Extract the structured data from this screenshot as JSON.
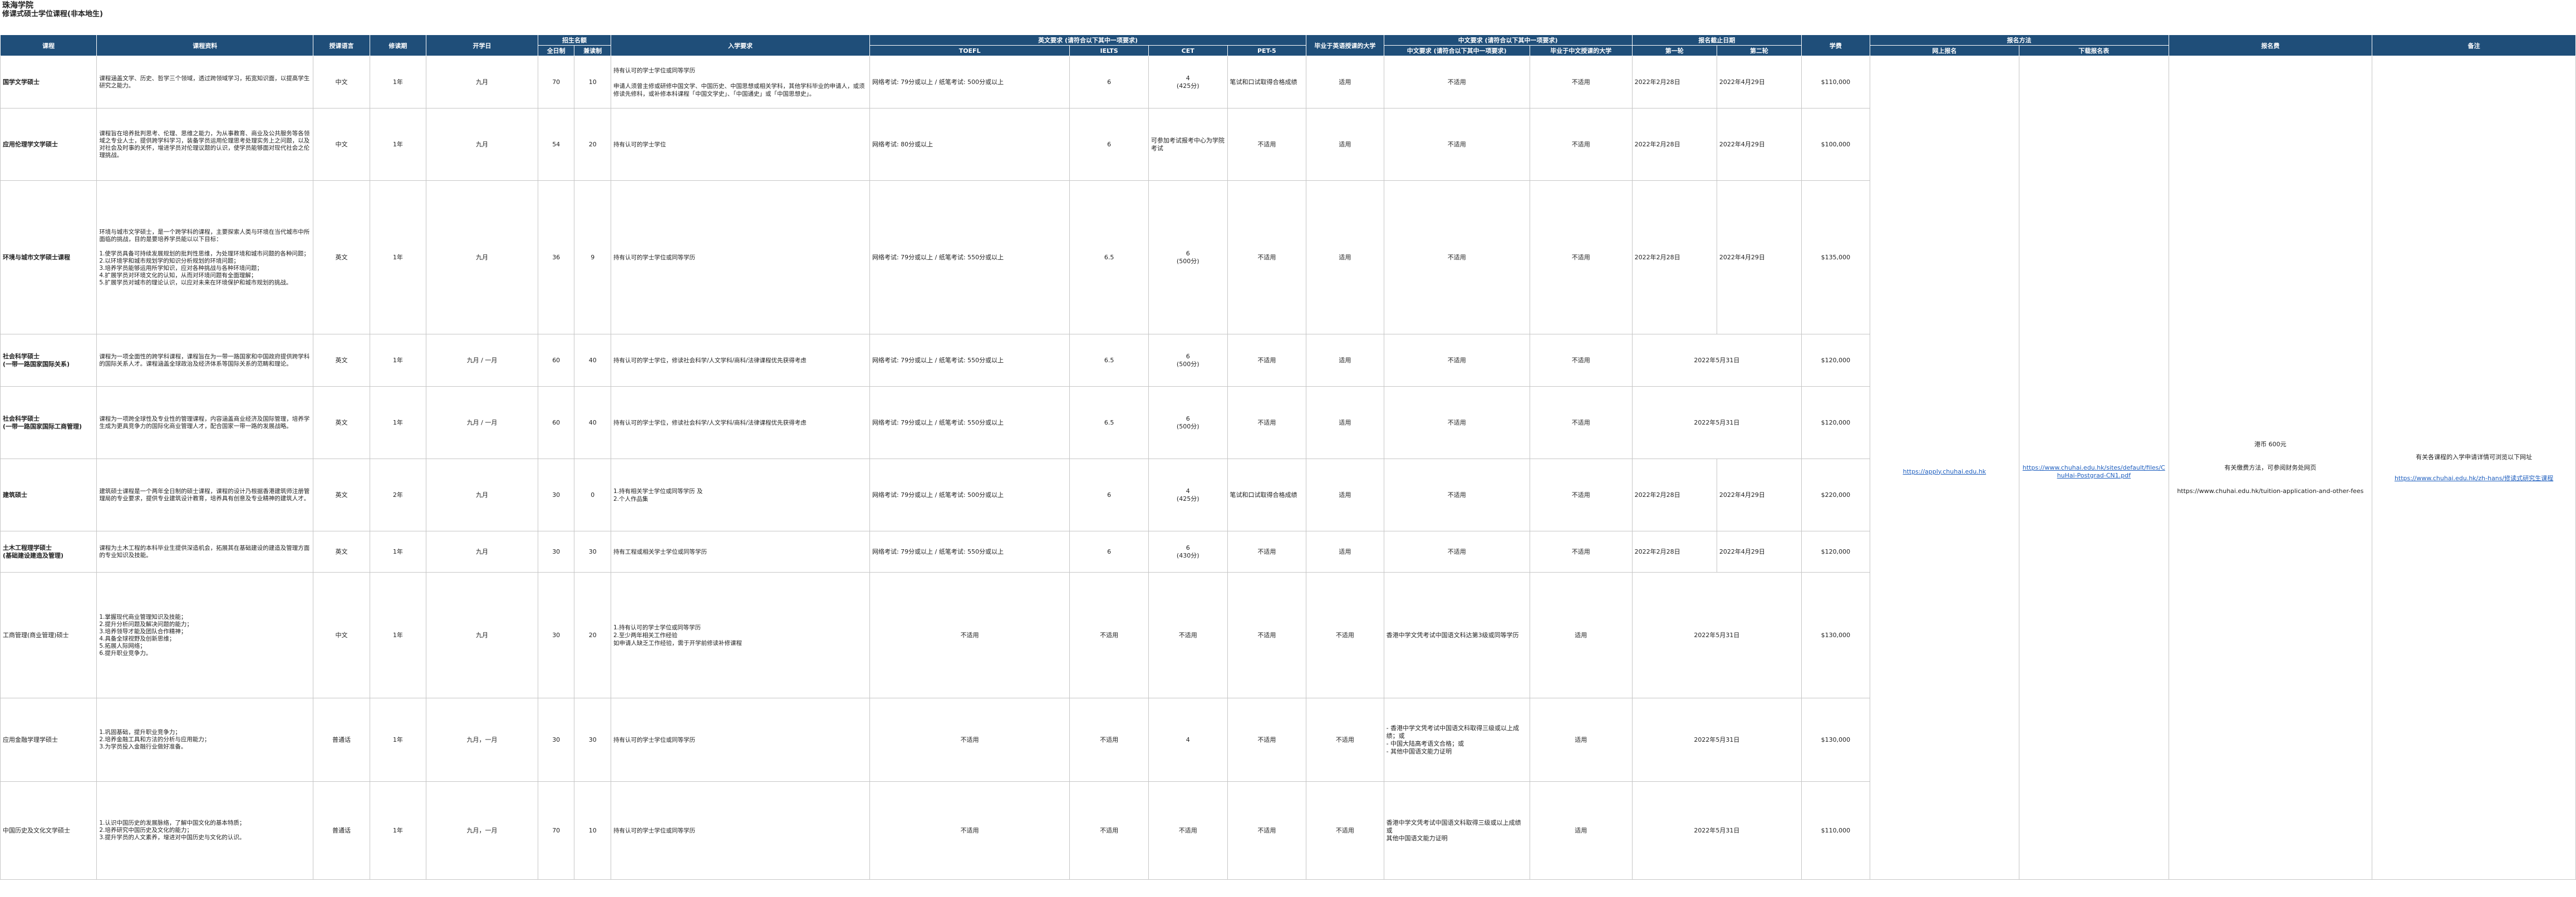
{
  "title": {
    "line1": "珠海学院",
    "line2": "修课式硕士学位课程(非本地生)"
  },
  "headers": {
    "program": "课程",
    "detail": "课程资料",
    "language": "授课语言",
    "duration": "修读期",
    "intake": "开学日",
    "quota": "招生名额",
    "quota_total": "全日制",
    "quota_part": "兼读制",
    "entry": "入学要求",
    "english": "英文要求 (请符合以下其中一项要求)",
    "toefl": "TOEFL",
    "ielts": "IELTS",
    "cet": "CET",
    "pet": "PET-5",
    "grad_english": "毕业于英语授课的大学",
    "chinese": "中文要求 (请符合以下其中一项要求)",
    "chinese_req": "中文要求 (请符合以下其中一项要求)",
    "grad_chinese": "毕业于中文授课的大学",
    "deadline": "报名截止日期",
    "round1": "第一轮",
    "round2": "第二轮",
    "tuition": "学费",
    "method": "报名方法",
    "online": "网上报名",
    "download": "下载报名表",
    "fee": "报名费",
    "remark": "备注"
  },
  "shared": {
    "online_link": "https://apply.chuhai.edu.hk",
    "download_link": "https://www.chuhai.edu.hk/sites/default/files/ChuHai-Postgrad-CN1.pdf",
    "fee_line1": "港币 600元",
    "fee_line2": "有关缴费方法，可参阅财务处网页",
    "fee_line3": "https://www.chuhai.edu.hk/tuition-application-and-other-fees",
    "remark_line1": "有关各课程的入学申请详情可浏览以下网址",
    "remark_line2": "https://www.chuhai.edu.hk/zh-hans/修读式研究生课程"
  },
  "rows": [
    {
      "name": "国学文学硕士",
      "detail": "课程涵盖文学、历史、哲学三个领域，透过跨领域学习，拓宽知识面，以提高学生研究之能力。",
      "language": "中文",
      "duration": "1年",
      "intake": "九月",
      "full": "70",
      "part": "10",
      "entry": "持有认可的学士学位或同等学历\n\n申请人须曾主修或研修中国文学、中国历史、中国思想或相关学科，其他学科毕业的申请人，或须修读先修科，或补修本科课程「中国文学史」、「中国通史」或「中国思想史」。",
      "toefl": "网络考试: 79分或以上 / 纸笔考试: 500分或以上",
      "ielts": "6",
      "cet": "4\n(425分)",
      "pet": "笔试和口试取得合格成绩",
      "grad_en": "适用",
      "chinese": "不适用",
      "grad_cn": "不适用",
      "round1": "2022年2月28日",
      "round2": "2022年4月29日",
      "tuition": "$110,000"
    },
    {
      "name": "应用伦理学文学硕士",
      "detail": "课程旨在培养批判思考、伦理、思维之能力，为从事教育、商业及公共服务等各领域之专业人士，提供跨学科学习，装备学员运用伦理思考处理实务上之问题，以及对社会及时事的关怀，增进学员对伦理议题的认识，使学员能够面对现代社会之伦理挑战。",
      "language": "中文",
      "duration": "1年",
      "intake": "九月",
      "full": "54",
      "part": "20",
      "entry": "持有认可的学士学位",
      "toefl": "网络考试: 80分或以上",
      "ielts": "6",
      "cet": "可参加考试报考中心为学院考试",
      "pet": "不适用",
      "grad_en": "适用",
      "chinese": "不适用",
      "grad_cn": "不适用",
      "round1": "2022年2月28日",
      "round2": "2022年4月29日",
      "tuition": "$100,000"
    },
    {
      "name": "环境与城市文学硕士课程",
      "detail": "环境与城市文学硕士，是一个跨学科的课程，主要探索人类与环境在当代城市中所面临的挑战，目的是要培养学员能以以下目标：\n\n1.使学员具备可持续发展规划的批判性思维，为处理环境和城市问题的各种问题；\n2.以环境学和城市规划学的知识分析规划的环境问题；\n3.培养学员能够运用所学知识，应对各种挑战与各种环境问题；\n4.扩展学员对环境文化的认知，从而对环境问题有全面理解；\n5.扩展学员对城市的理论认识，以应对未来在环境保护和城市规划的挑战。",
      "language": "英文",
      "duration": "1年",
      "intake": "九月",
      "full": "36",
      "part": "9",
      "entry": "持有认可的学士学位或同等学历",
      "toefl": "网络考试: 79分或以上 / 纸笔考试: 550分或以上",
      "ielts": "6.5",
      "cet": "6\n(500分)",
      "pet": "不适用",
      "grad_en": "适用",
      "chinese": "不适用",
      "grad_cn": "不适用",
      "round1": "2022年2月28日",
      "round2": "2022年4月29日",
      "tuition": "$135,000"
    },
    {
      "name": "社会科学硕士\n(一带一路国家国际关系)",
      "detail": "课程为一项全面性的跨学科课程，课程旨在为一带一路国家和中国政府提供跨学科的国际关系人才。课程涵盖全球政治及经济体系等国际关系的范畴和理论。",
      "language": "英文",
      "duration": "1年",
      "intake": "九月 / 一月",
      "full": "60",
      "part": "40",
      "entry": "持有认可的学士学位，修读社会科学/人文学科/商科/法律课程优先获得考虑",
      "toefl": "网络考试: 79分或以上 / 纸笔考试: 550分或以上",
      "ielts": "6.5",
      "cet": "6\n(500分)",
      "pet": "不适用",
      "grad_en": "适用",
      "chinese": "不适用",
      "grad_cn": "不适用",
      "round_merged": "2022年5月31日",
      "tuition": "$120,000"
    },
    {
      "name": "社会科学硕士\n(一带一路国家国际工商管理)",
      "detail": "课程为一项跨全球性及专业性的管理课程，内容涵盖商业经济及国际管理，培养学生成为更具竞争力的国际化商业管理人才，配合国家一带一路的发展战略。",
      "language": "英文",
      "duration": "1年",
      "intake": "九月 / 一月",
      "full": "60",
      "part": "40",
      "entry": "持有认可的学士学位，修读社会科学/人文学科/商科/法律课程优先获得考虑",
      "toefl": "网络考试: 79分或以上 / 纸笔考试: 550分或以上",
      "ielts": "6.5",
      "cet": "6\n(500分)",
      "pet": "不适用",
      "grad_en": "适用",
      "chinese": "不适用",
      "grad_cn": "不适用",
      "round_merged": "2022年5月31日",
      "tuition": "$120,000"
    },
    {
      "name": "建筑硕士",
      "detail": "建筑硕士课程是一个两年全日制的硕士课程，课程的设计乃根据香港建筑师注册管理局的专业要求，提供专业建筑设计教育，培养具有创意及专业精神的建筑人才。",
      "language": "英文",
      "duration": "2年",
      "intake": "九月",
      "full": "30",
      "part": "0",
      "entry": "1.持有相关学士学位或同等学历 及\n2.个人作品集",
      "toefl": "网络考试: 79分或以上 / 纸笔考试: 500分或以上",
      "ielts": "6",
      "cet": "4\n(425分)",
      "pet": "笔试和口试取得合格成绩",
      "grad_en": "适用",
      "chinese": "不适用",
      "grad_cn": "不适用",
      "round1": "2022年2月28日",
      "round2": "2022年4月29日",
      "tuition": "$220,000"
    },
    {
      "name": "土木工程理学硕士\n(基础建设建造及管理)",
      "detail": "课程为土木工程的本科毕业生提供深造机会，拓展其在基础建设的建造及管理方面的专业知识及技能。",
      "language": "英文",
      "duration": "1年",
      "intake": "九月",
      "full": "30",
      "part": "30",
      "entry": "持有工程或相关学士学位或同等学历",
      "toefl": "网络考试: 79分或以上 / 纸笔考试: 550分或以上",
      "ielts": "6",
      "cet": "6\n(430分)",
      "pet": "不适用",
      "grad_en": "适用",
      "chinese": "不适用",
      "grad_cn": "不适用",
      "round1": "2022年2月28日",
      "round2": "2022年4月29日",
      "tuition": "$120,000"
    },
    {
      "name": "工商管理(商业管理)硕士",
      "detail": "1.掌握现代商业管理知识及技能；\n2.提升分析问题及解决问题的能力；\n3.培养领导才能及团队合作精神；\n4.具备全球视野及创新思维；\n5.拓展人际网络；\n6.提升职业竞争力。",
      "language": "中文",
      "duration": "1年",
      "intake": "九月",
      "full": "30",
      "part": "20",
      "entry": "1.持有认可的学士学位或同等学历\n2.至少两年相关工作经验\n  如申请人缺乏工作经验，需于开学前修读补修课程",
      "toefl": "不适用",
      "ielts": "不适用",
      "cet": "不适用",
      "pet": "不适用",
      "grad_en": "不适用",
      "chinese": "香港中学文凭考试中国语文科达第3级或同等学历",
      "grad_cn": "适用",
      "round_merged": "2022年5月31日",
      "tuition": "$130,000"
    },
    {
      "name": "应用金融学理学硕士",
      "detail": "1.巩固基础，提升职业竞争力；\n2.培养金融工具和方法的分析与应用能力；\n3.为学员投入金融行业做好准备。",
      "language": "普通话",
      "duration": "1年",
      "intake": "九月，一月",
      "full": "30",
      "part": "30",
      "entry": "持有认可的学士学位或同等学历",
      "toefl": "不适用",
      "ielts": "不适用",
      "cet": "4",
      "pet": "不适用",
      "grad_en": "不适用",
      "chinese": "- 香港中学文凭考试中国语文科取得三级或以上成绩；或\n- 中国大陆高考语文合格；或\n- 其他中国语文能力证明",
      "grad_cn": "适用",
      "round_merged": "2022年5月31日",
      "tuition": "$130,000"
    },
    {
      "name": "中国历史及文化文学硕士",
      "detail": "1.认识中国历史的发展脉络，了解中国文化的基本特质；\n2.培养研究中国历史及文化的能力；\n3.提升学员的人文素养，增进对中国历史与文化的认识。",
      "language": "普通话",
      "duration": "1年",
      "intake": "九月，一月",
      "full": "70",
      "part": "10",
      "entry": "持有认可的学士学位或同等学历",
      "toefl": "不适用",
      "ielts": "不适用",
      "cet": "不适用",
      "pet": "不适用",
      "grad_en": "不适用",
      "chinese": "香港中学文凭考试中国语文科取得三级或以上成绩 或\n其他中国语文能力证明",
      "grad_cn": "适用",
      "round_merged": "2022年5月31日",
      "tuition": "$110,000"
    }
  ]
}
